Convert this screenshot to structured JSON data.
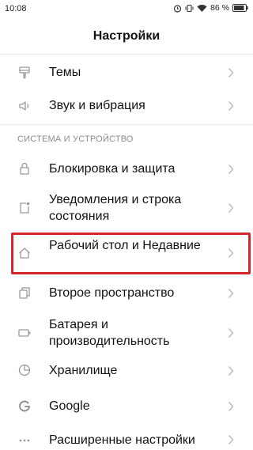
{
  "status_bar": {
    "time": "10:08",
    "battery": "86 %"
  },
  "header": {
    "title": "Настройки"
  },
  "items_top": [
    {
      "label": "Темы",
      "icon": "brush-icon"
    },
    {
      "label": "Звук и вибрация",
      "icon": "speaker-icon"
    }
  ],
  "section": {
    "label": "СИСТЕМА И УСТРОЙСТВО"
  },
  "items_system": [
    {
      "label": "Блокировка и защита",
      "icon": "lock-icon"
    },
    {
      "label": "Уведомления и строка состояния",
      "icon": "notification-icon"
    },
    {
      "label": "Рабочий стол и Недавние",
      "icon": "home-icon"
    },
    {
      "label": "Второе пространство",
      "icon": "second-space-icon"
    },
    {
      "label": "Батарея и производительность",
      "icon": "battery-icon"
    },
    {
      "label": "Хранилище",
      "icon": "storage-icon"
    },
    {
      "label": "Google",
      "icon": "google-icon"
    },
    {
      "label": "Расширенные настройки",
      "icon": "more-icon"
    }
  ],
  "colors": {
    "highlight": "#d3262c",
    "section_text": "#8c8c8c"
  }
}
